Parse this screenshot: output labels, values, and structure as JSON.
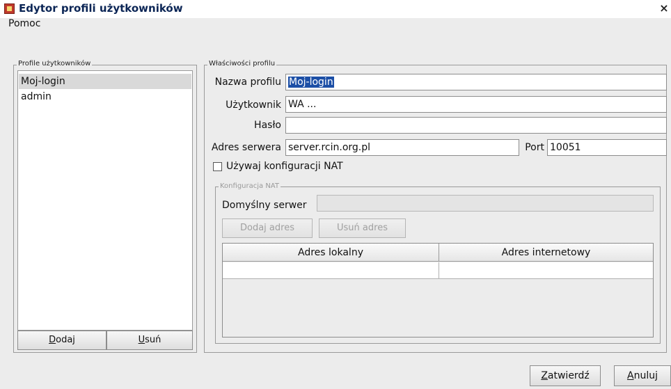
{
  "window": {
    "title": "Edytor profili użytkowników",
    "close_symbol": "×"
  },
  "menu": {
    "help": "Pomoc"
  },
  "profiles": {
    "group_label": "Profile użytkowników",
    "items": [
      {
        "label": "Moj-login",
        "selected": true
      },
      {
        "label": "admin",
        "selected": false
      }
    ],
    "add_button": {
      "mnemonic": "D",
      "rest": "odaj"
    },
    "remove_button": {
      "mnemonic": "U",
      "rest": "suń"
    }
  },
  "properties": {
    "group_label": "Właściwości profilu",
    "profile_name_label": "Nazwa profilu",
    "profile_name_value": "Moj-login",
    "user_label": "Użytkownik",
    "user_value": "WA ...",
    "password_label": "Hasło",
    "password_value": "",
    "server_label": "Adres serwera",
    "server_value": "server.rcin.org.pl",
    "port_label": "Port",
    "port_value": "10051",
    "nat_checkbox_label": "Używaj konfiguracji NAT",
    "nat_checked": false
  },
  "nat": {
    "group_label": "Konfiguracja NAT",
    "default_server_label": "Domyślny serwer",
    "default_server_value": "",
    "add_address_button": "Dodaj adres",
    "remove_address_button": "Usuń adres",
    "table_headers": [
      "Adres lokalny",
      "Adres internetowy"
    ],
    "rows": [
      [
        "",
        ""
      ]
    ]
  },
  "footer": {
    "confirm_button": {
      "mnemonic": "Z",
      "rest": "atwierdź"
    },
    "cancel_button": {
      "mnemonic": "A",
      "rest": "nuluj"
    }
  }
}
